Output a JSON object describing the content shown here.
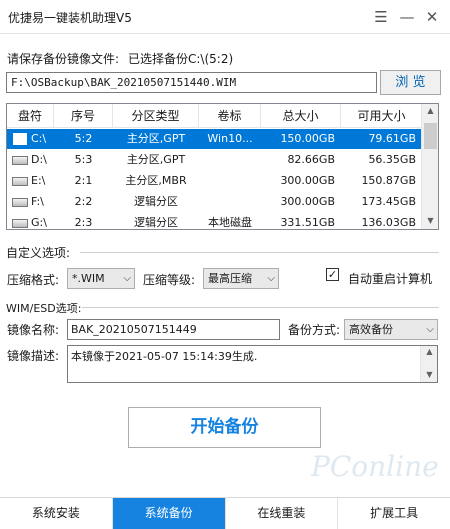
{
  "window": {
    "title": "优捷易一键装机助理V5",
    "menu_icon": "menu-icon",
    "minimize_icon": "minimize-icon",
    "close_icon": "close-icon"
  },
  "backup_path": {
    "prompt": "请保存备份镜像文件:",
    "selected_label": "已选择备份C:\\(5:2)",
    "value": "F:\\OSBackup\\BAK_20210507151440.WIM",
    "browse_label": "浏 览"
  },
  "partition_table": {
    "columns": [
      "盘符",
      "序号",
      "分区类型",
      "卷标",
      "总大小",
      "可用大小"
    ],
    "rows": [
      {
        "drive": "C:\\",
        "index": "5:2",
        "type": "主分区,GPT",
        "label": "Win10...",
        "total": "150.00GB",
        "free": "79.61GB",
        "selected": true
      },
      {
        "drive": "D:\\",
        "index": "5:3",
        "type": "主分区,GPT",
        "label": "",
        "total": "82.66GB",
        "free": "56.35GB",
        "selected": false
      },
      {
        "drive": "E:\\",
        "index": "2:1",
        "type": "主分区,MBR",
        "label": "",
        "total": "300.00GB",
        "free": "150.87GB",
        "selected": false
      },
      {
        "drive": "F:\\",
        "index": "2:2",
        "type": "逻辑分区",
        "label": "",
        "total": "300.00GB",
        "free": "173.45GB",
        "selected": false
      },
      {
        "drive": "G:\\",
        "index": "2:3",
        "type": "逻辑分区",
        "label": "本地磁盘",
        "total": "331.51GB",
        "free": "136.03GB",
        "selected": false
      }
    ]
  },
  "options": {
    "section_title": "自定义选项:",
    "compress_format_label": "压缩格式:",
    "compress_format_value": "*.WIM",
    "compress_level_label": "压缩等级:",
    "compress_level_value": "最高压缩",
    "auto_restart_label": "自动重启计算机",
    "auto_restart_checked": true
  },
  "wim": {
    "section_title": "WIM/ESD选项:",
    "image_name_label": "镜像名称:",
    "image_name_value": "BAK_20210507151449",
    "backup_mode_label": "备份方式:",
    "backup_mode_value": "高效备份",
    "description_label": "镜像描述:",
    "description_value": "本镜像于2021-05-07 15:14:39生成."
  },
  "start_button": "开始备份",
  "bottom_tabs": [
    {
      "label": "系统安装",
      "active": false
    },
    {
      "label": "系统备份",
      "active": true
    },
    {
      "label": "在线重装",
      "active": false
    },
    {
      "label": "扩展工具",
      "active": false
    }
  ],
  "watermark_text": "PConline"
}
